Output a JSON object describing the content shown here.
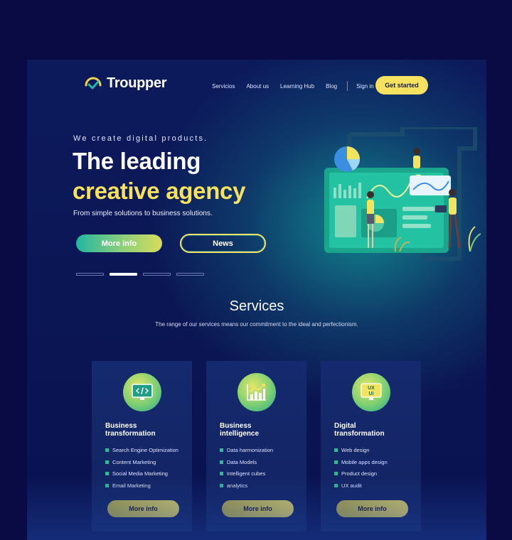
{
  "header": {
    "logo_text": "Troupper",
    "nav": [
      "Servicios",
      "About us",
      "Learning Hub",
      "Blog"
    ],
    "signin": "Sign in",
    "cta": "Get started"
  },
  "hero": {
    "tagline": "We create digital products.",
    "title_line1": "The leading",
    "title_line2": "creative agency",
    "subtitle": "From simple solutions to business solutions.",
    "primary_button": "More info",
    "secondary_button": "News",
    "slides": 4,
    "active_slide": 2
  },
  "services": {
    "title": "Services",
    "subtitle": "The range of our services means our commitment to the ideal and perfectionism.",
    "cards": [
      {
        "icon": "code-monitor-icon",
        "title_line1": "Business",
        "title_line2": "transformation",
        "items": [
          "Search Engine Optimization",
          "Content Marketing",
          "Social Media Marketing",
          "Email Marketing"
        ],
        "button": "More info"
      },
      {
        "icon": "growth-chart-icon",
        "title_line1": "Business",
        "title_line2": "intelligence",
        "items": [
          "Data harmonization",
          "Data Models",
          "Intelligent cubes",
          "analytics"
        ],
        "button": "More info"
      },
      {
        "icon": "ux-ui-monitor-icon",
        "title_line1": "Digital",
        "title_line2": "transformation",
        "items": [
          "Web design",
          "Mobile apps design",
          "Product design",
          "UX audit"
        ],
        "button": "More info"
      }
    ]
  },
  "colors": {
    "background": "#0a0b44",
    "accent_yellow": "#f6e25e",
    "accent_teal": "#22b6a0"
  }
}
